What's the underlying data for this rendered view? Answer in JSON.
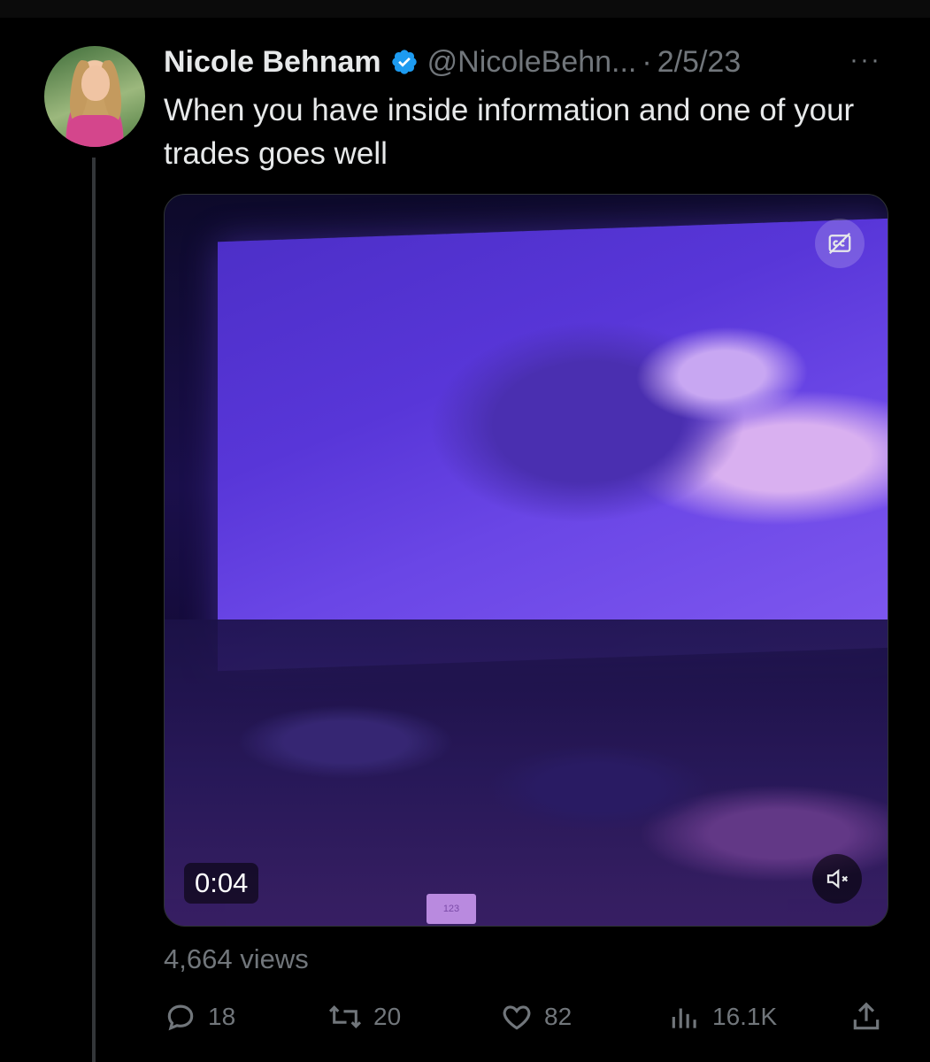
{
  "tweet": {
    "author_name": "Nicole Behnam",
    "handle": "@NicoleBehn...",
    "separator": "·",
    "date": "2/5/23",
    "more_label": "···",
    "text": "When you have inside information and one of your trades goes well"
  },
  "media": {
    "timestamp": "0:04",
    "table_tag": "123"
  },
  "stats": {
    "views_label": "4,664 views"
  },
  "actions": {
    "replies": "18",
    "reposts": "20",
    "likes": "82",
    "views": "16.1K"
  },
  "colors": {
    "background": "#000000",
    "text_primary": "#e7e9ea",
    "text_secondary": "#71767b",
    "verified_badge": "#1d9bf0",
    "thread_line": "#333639"
  },
  "icons": {
    "verified": "verified-badge-icon",
    "captions": "closed-captions-off-icon",
    "mute": "speaker-muted-icon",
    "reply": "reply-bubble-icon",
    "repost": "repost-arrows-icon",
    "like": "heart-icon",
    "analytics": "bar-chart-icon",
    "share": "share-upload-icon"
  }
}
